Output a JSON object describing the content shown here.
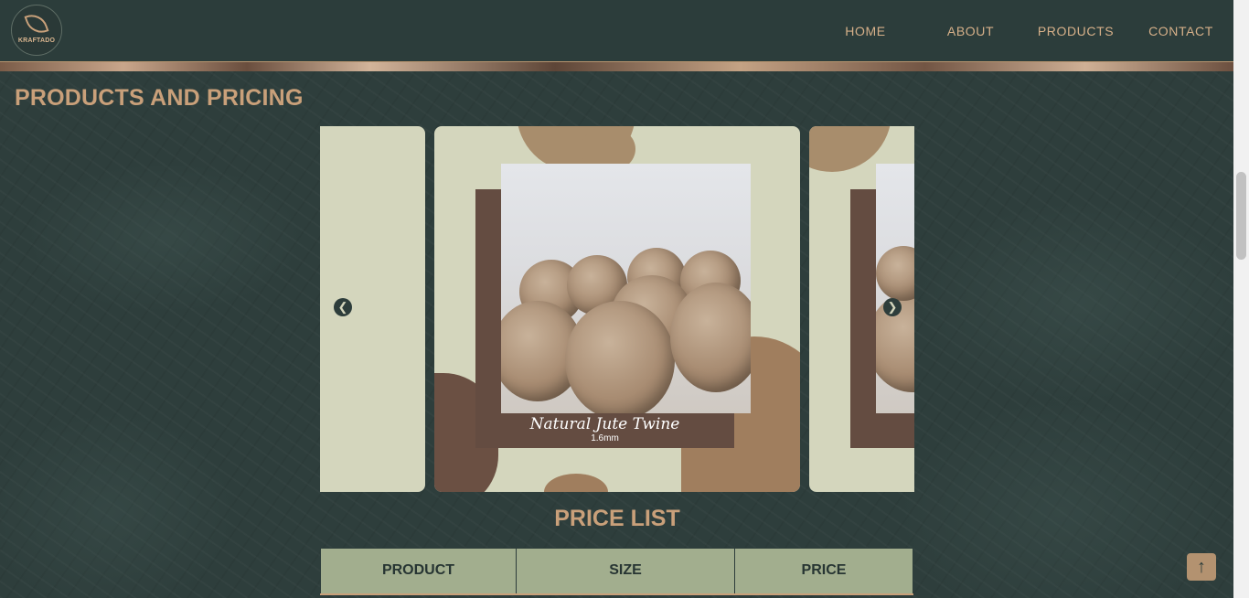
{
  "header": {
    "logo_text": "KRAFTADO",
    "nav": [
      "HOME",
      "ABOUT",
      "PRODUCTS",
      "CONTACT"
    ]
  },
  "products": {
    "title": "PRODUCTS AND PRICING",
    "carousel": {
      "prev_icon": "chevron-left-icon",
      "next_icon": "chevron-right-icon",
      "active_slide": {
        "name": "Natural Jute Twine",
        "size": "1.6mm"
      }
    }
  },
  "price_list": {
    "title": "PRICE LIST",
    "columns": [
      "PRODUCT",
      "SIZE",
      "PRICE"
    ]
  },
  "controls": {
    "back_to_top_icon": "arrow-up-icon"
  },
  "colors": {
    "background": "#2f3f3d",
    "accent": "#c9a07a",
    "table_header": "#a2ae8e"
  }
}
